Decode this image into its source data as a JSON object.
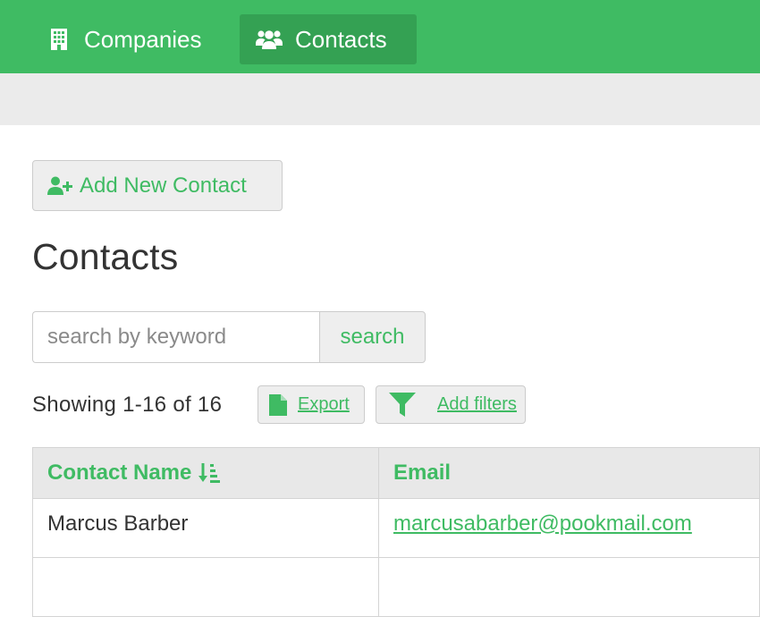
{
  "topnav": {
    "companies_label": "Companies",
    "contacts_label": "Contacts",
    "brand_color": "#3fbb63",
    "active_color": "#34a153"
  },
  "toolbar": {
    "add_contact_label": "Add New Contact"
  },
  "page": {
    "title": "Contacts"
  },
  "search": {
    "placeholder": "search by keyword",
    "button_label": "search"
  },
  "results": {
    "showing_text": "Showing 1-16 of 16",
    "export_label": "Export",
    "filters_label": "Add filters"
  },
  "table": {
    "columns": [
      "Contact Name",
      "Email"
    ],
    "rows": [
      {
        "name": "Marcus Barber",
        "email": "marcusabarber@pookmail.com"
      },
      {
        "name": "",
        "email": ""
      }
    ]
  },
  "icons": {
    "companies": "building-icon",
    "contacts": "users-icon",
    "add_contact": "user-plus-icon",
    "export": "file-icon",
    "filter": "funnel-icon",
    "sort": "sort-ascending-icon"
  }
}
